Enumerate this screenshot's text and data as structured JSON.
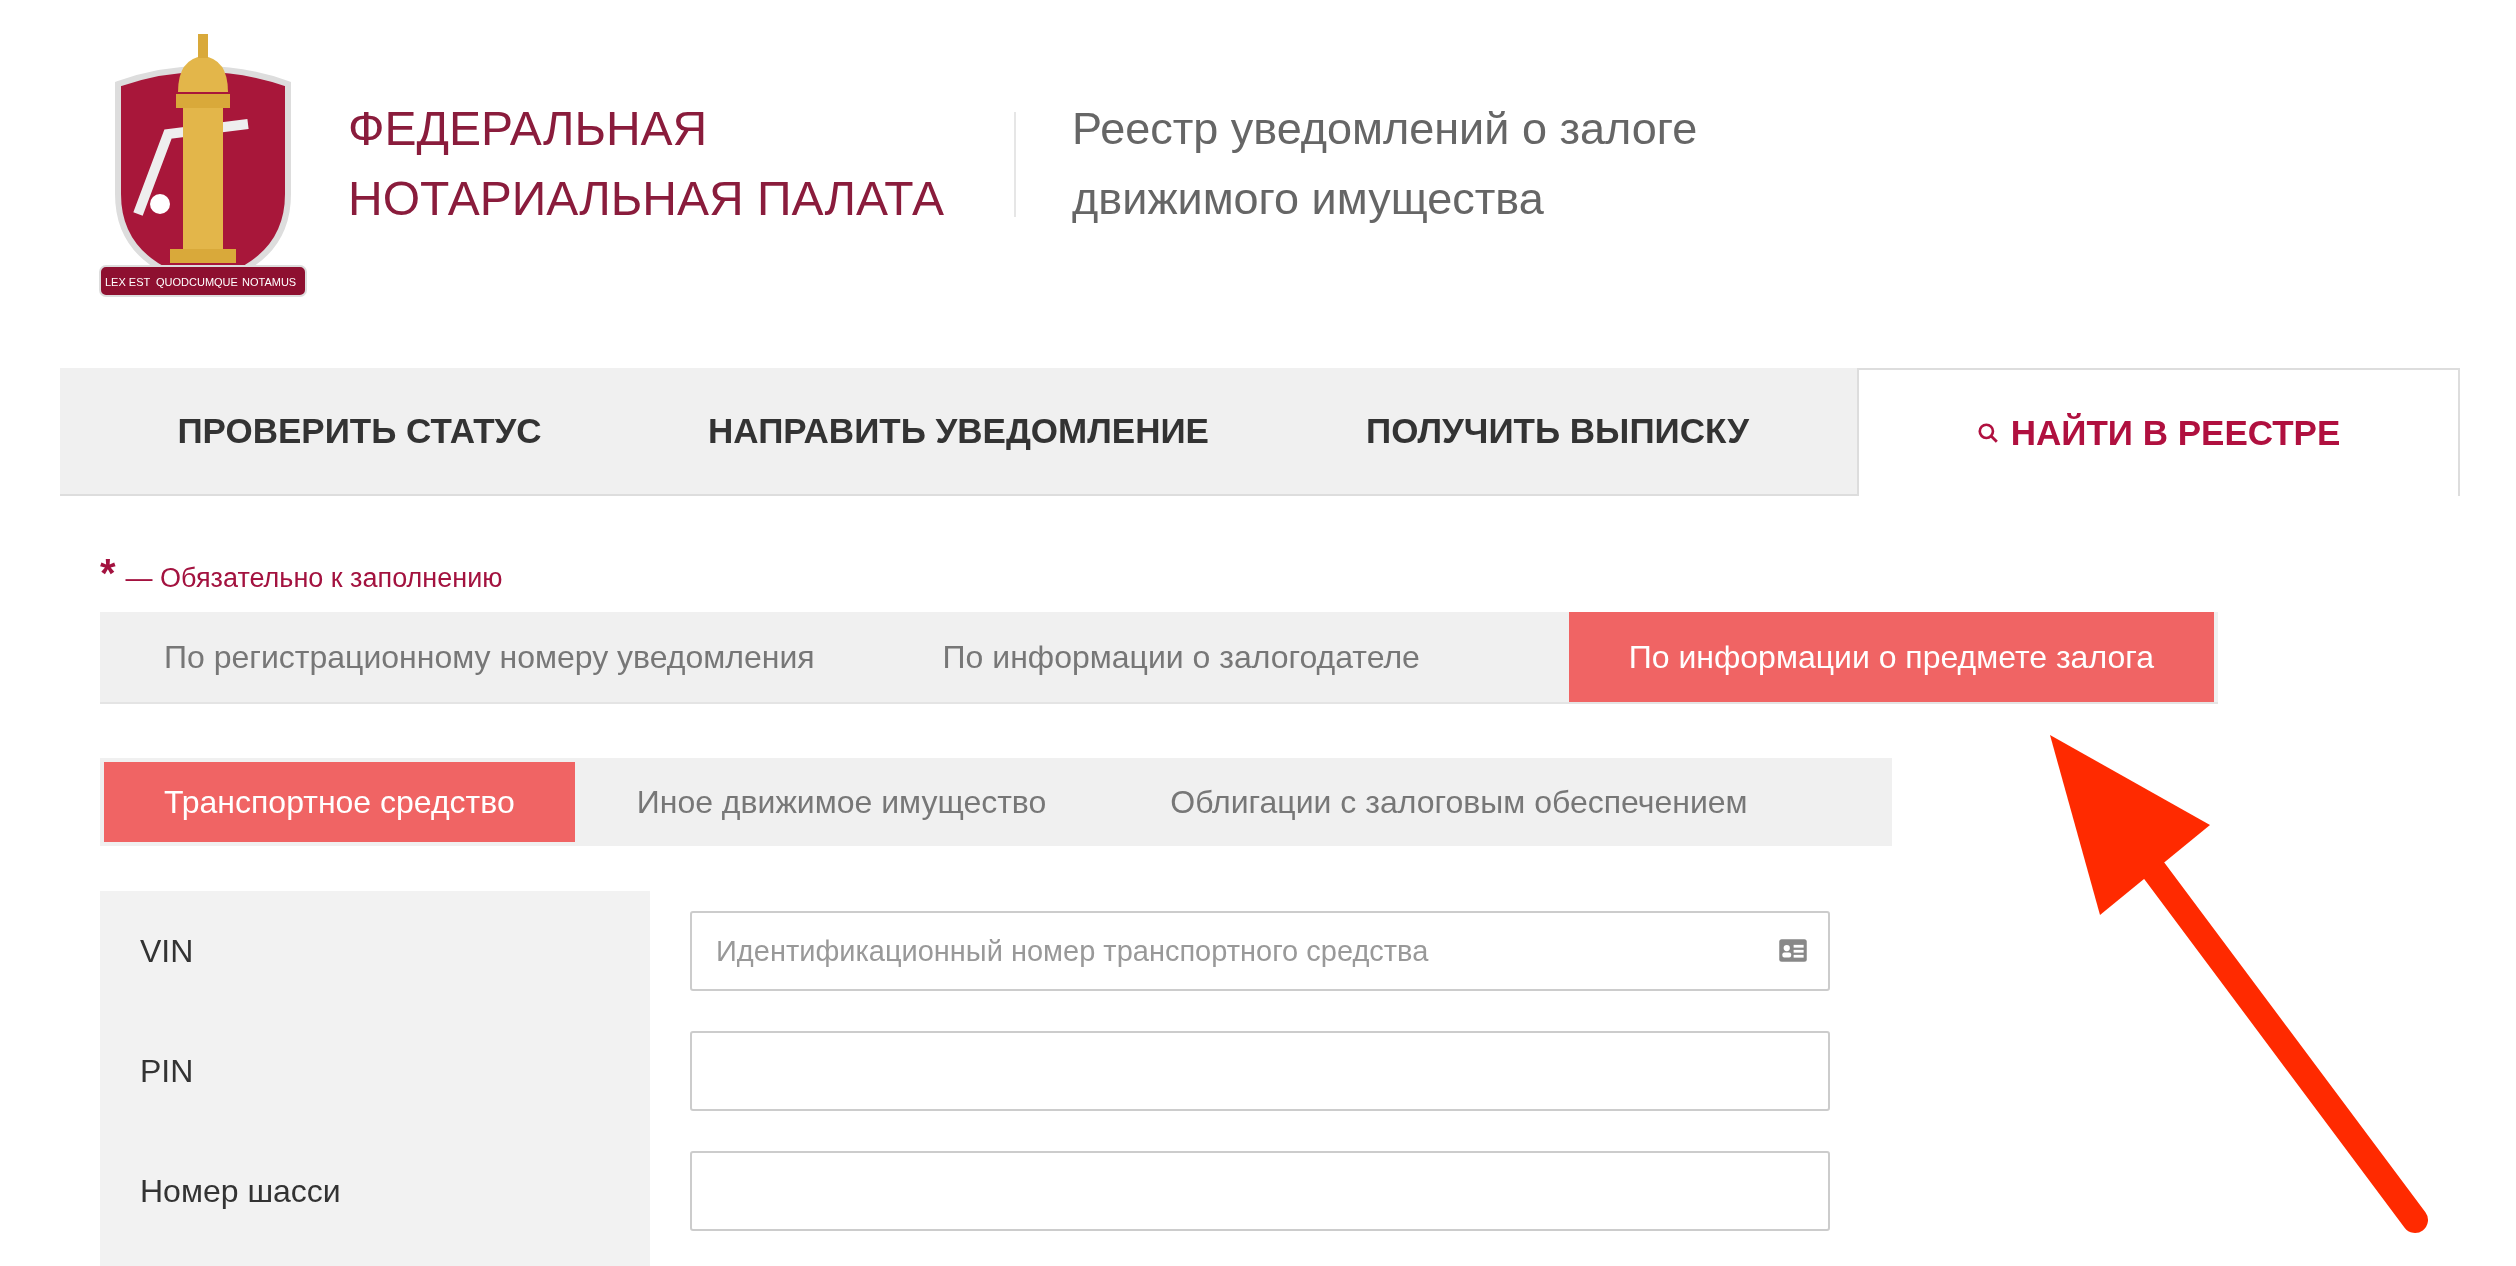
{
  "header": {
    "emblem_motto": [
      "LEX EST",
      "QUODCUMQUE",
      "NOTAMUS"
    ],
    "org_name": [
      "ФЕДЕРАЛЬНАЯ",
      "НОТАРИАЛЬНАЯ ПАЛАТА"
    ],
    "registry_name": [
      "Реестр уведомлений о залоге",
      "движимого имущества"
    ]
  },
  "nav_tabs": [
    {
      "label": "ПРОВЕРИТЬ СТАТУС",
      "selected": false,
      "search_icon": false
    },
    {
      "label": "НАПРАВИТЬ УВЕДОМЛЕНИЕ",
      "selected": false,
      "search_icon": false
    },
    {
      "label": "ПОЛУЧИТЬ ВЫПИСКУ",
      "selected": false,
      "search_icon": false
    },
    {
      "label": "НАЙТИ В РЕЕСТРЕ",
      "selected": true,
      "search_icon": true
    }
  ],
  "required_note": {
    "mark": "*",
    "text": "— Обязательно к заполнению"
  },
  "search_tabs": [
    {
      "label": "По регистрационному номеру уведомления",
      "selected": false
    },
    {
      "label": "По информации о залогодателе",
      "selected": false
    },
    {
      "label": "По информации о предмете залога",
      "selected": true
    }
  ],
  "property_tabs": [
    {
      "label": "Транспортное средство",
      "selected": true
    },
    {
      "label": "Иное движимое имущество",
      "selected": false
    },
    {
      "label": "Облигации с залоговым обеспечением",
      "selected": false
    }
  ],
  "fields": [
    {
      "label": "VIN",
      "placeholder": "Идентификационный номер транспортного средства",
      "card_icon": true
    },
    {
      "label": "PIN",
      "card_icon": false
    },
    {
      "label": "Номер шасси",
      "card_icon": false
    }
  ]
}
